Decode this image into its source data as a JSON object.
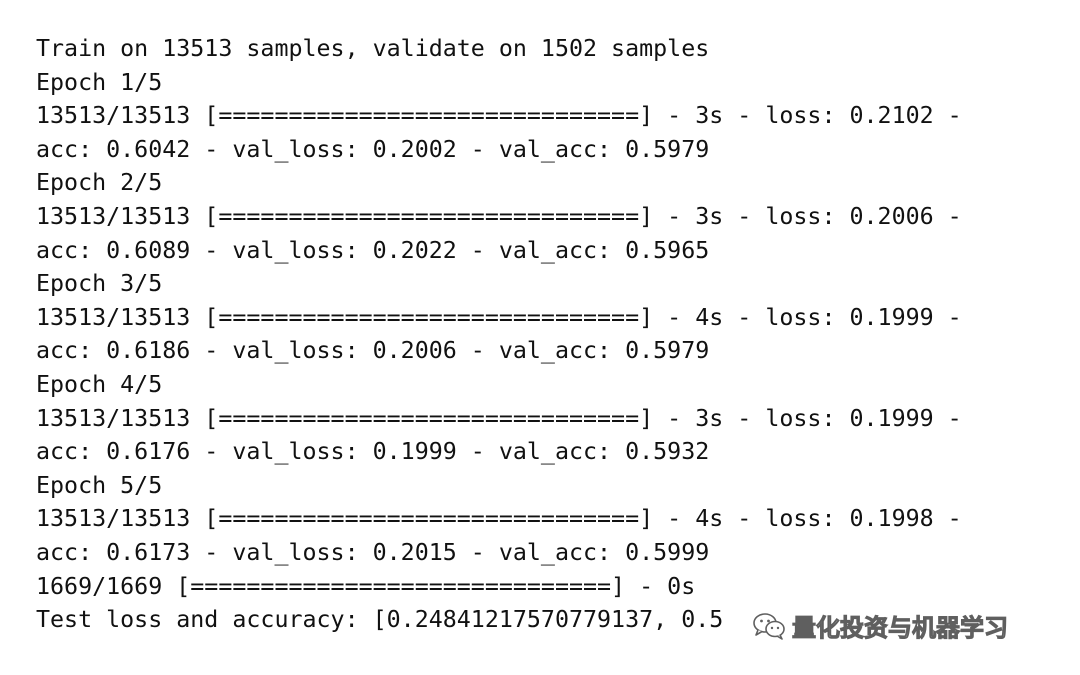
{
  "console": {
    "lines": [
      "Train on 13513 samples, validate on 1502 samples",
      "Epoch 1/5",
      "13513/13513 [==============================] - 3s - loss: 0.2102 -",
      "acc: 0.6042 - val_loss: 0.2002 - val_acc: 0.5979",
      "Epoch 2/5",
      "13513/13513 [==============================] - 3s - loss: 0.2006 -",
      "acc: 0.6089 - val_loss: 0.2022 - val_acc: 0.5965",
      "Epoch 3/5",
      "13513/13513 [==============================] - 4s - loss: 0.1999 -",
      "acc: 0.6186 - val_loss: 0.2006 - val_acc: 0.5979",
      "Epoch 4/5",
      "13513/13513 [==============================] - 3s - loss: 0.1999 -",
      "acc: 0.6176 - val_loss: 0.1999 - val_acc: 0.5932",
      "Epoch 5/5",
      "13513/13513 [==============================] - 4s - loss: 0.1998 -",
      "acc: 0.6173 - val_loss: 0.2015 - val_acc: 0.5999",
      "1669/1669 [==============================] - 0s",
      "Test loss and accuracy: [0.24841217570779137, 0.5"
    ]
  },
  "watermark": {
    "icon": "wechat-icon",
    "text": "量化投资与机器学习"
  }
}
